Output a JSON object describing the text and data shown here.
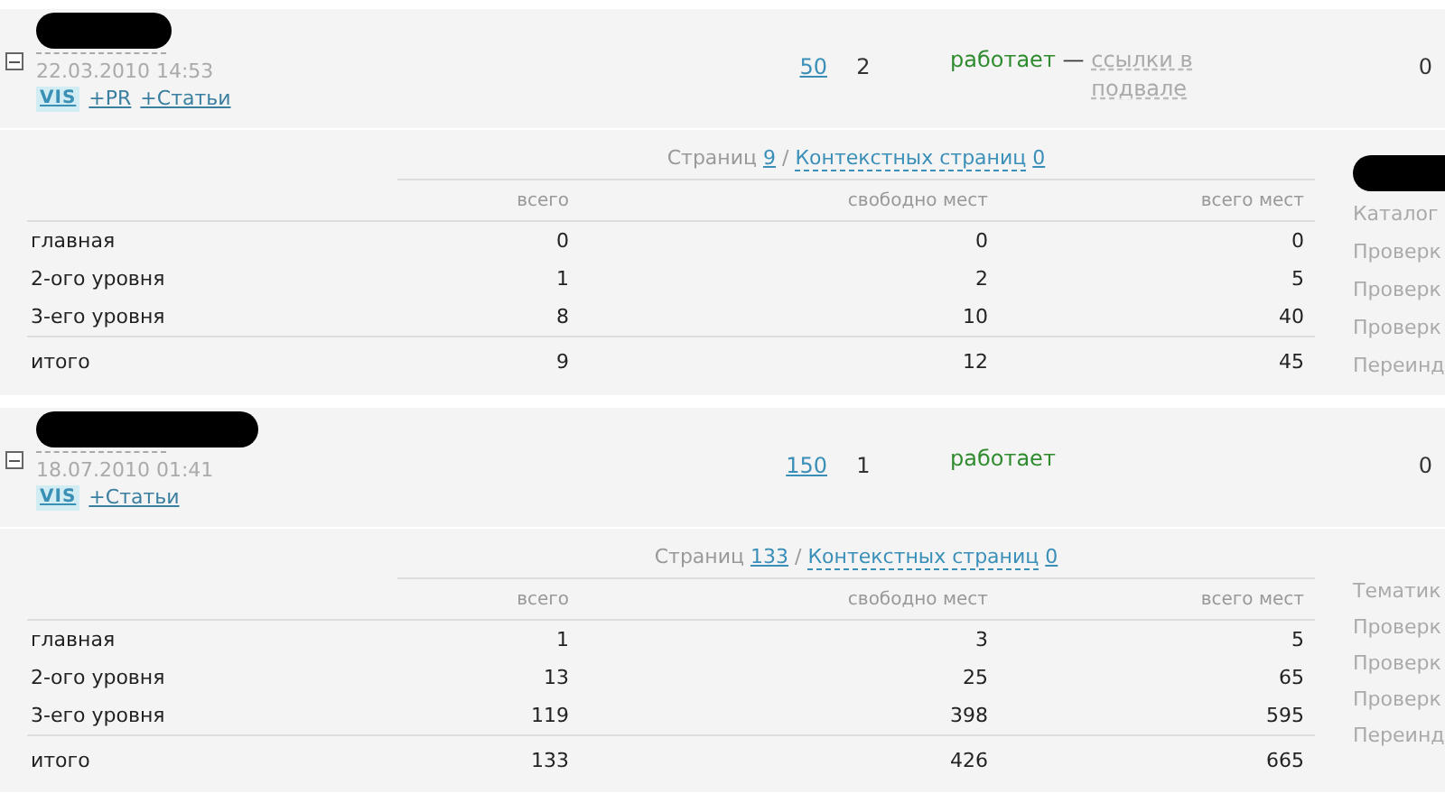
{
  "sites": [
    {
      "name_redacted": true,
      "date": "22.03.2010 14:53",
      "expanded": true,
      "tags": [
        {
          "kind": "badge",
          "label": "VIS"
        },
        {
          "kind": "link",
          "label": "+PR"
        },
        {
          "kind": "link",
          "label": "+Статьи"
        }
      ],
      "pages": "50",
      "count": "2",
      "status": "работает",
      "status_separator": "—",
      "status_note": "ссылки в подвале",
      "last": "0",
      "detail": {
        "pages_label": "Страниц",
        "pages": "9",
        "separator": "/",
        "context_label": "Контекстных страниц",
        "context": "0",
        "columns": [
          "всего",
          "свободно мест",
          "всего мест"
        ],
        "rows": [
          {
            "label": "главная",
            "values": [
              "0",
              "0",
              "0"
            ]
          },
          {
            "label": "2-ого уровня",
            "values": [
              "1",
              "2",
              "5"
            ]
          },
          {
            "label": "3-его уровня",
            "values": [
              "8",
              "10",
              "40"
            ]
          }
        ],
        "total_row": {
          "label": "итого",
          "values": [
            "9",
            "12",
            "45"
          ]
        },
        "side_redacted": true,
        "side_labels": [
          "Каталог",
          "Проверк",
          "Проверк",
          "Проверк",
          "Переинд"
        ]
      }
    },
    {
      "name_redacted": true,
      "date": "18.07.2010 01:41",
      "expanded": true,
      "tags": [
        {
          "kind": "badge",
          "label": "VIS"
        },
        {
          "kind": "link",
          "label": "+Статьи"
        }
      ],
      "pages": "150",
      "count": "1",
      "status": "работает",
      "last": "0",
      "detail": {
        "pages_label": "Страниц",
        "pages": "133",
        "separator": "/",
        "context_label": "Контекстных страниц",
        "context": "0",
        "columns": [
          "всего",
          "свободно мест",
          "всего мест"
        ],
        "rows": [
          {
            "label": "главная",
            "values": [
              "1",
              "3",
              "5"
            ]
          },
          {
            "label": "2-ого уровня",
            "values": [
              "13",
              "25",
              "65"
            ]
          },
          {
            "label": "3-его уровня",
            "values": [
              "119",
              "398",
              "595"
            ]
          }
        ],
        "total_row": {
          "label": "итого",
          "values": [
            "133",
            "426",
            "665"
          ]
        },
        "side_redacted": false,
        "side_labels": [
          "Тематик",
          "Проверк",
          "Проверк",
          "Проверк",
          "Переинд"
        ]
      }
    }
  ]
}
